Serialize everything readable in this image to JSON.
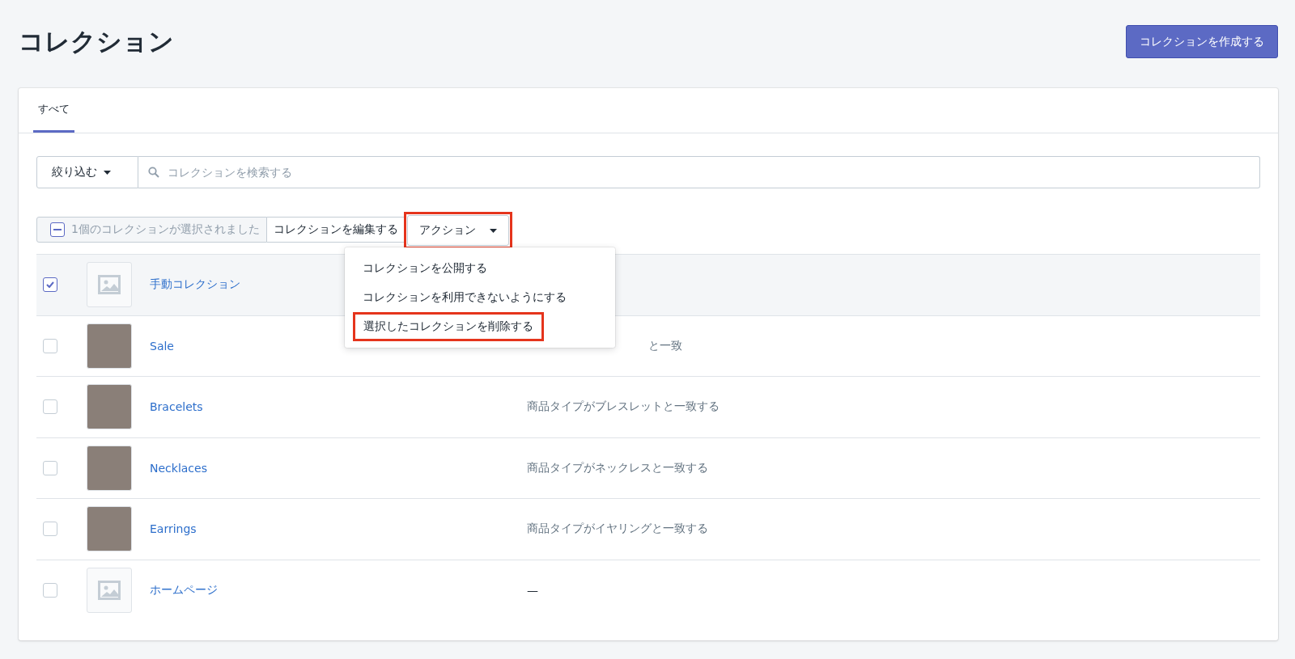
{
  "page": {
    "title": "コレクション",
    "primary_button": "コレクションを作成する"
  },
  "tabs": [
    {
      "label": "すべて",
      "selected": true
    }
  ],
  "filter": {
    "button": "絞り込む",
    "search_placeholder": "コレクションを検索する"
  },
  "bulk_bar": {
    "select_all_indeterminate": true,
    "selected_text": "1個のコレクションが選択されました",
    "edit_button": "コレクションを編集する",
    "action_button": {
      "label": "アクション",
      "highlighted": true
    }
  },
  "action_menu": {
    "open": true,
    "items": [
      {
        "label": "コレクションを公開する",
        "highlighted": false
      },
      {
        "label": "コレクションを利用できないようにする",
        "highlighted": false
      },
      {
        "label": "選択したコレクションを削除する",
        "highlighted": true
      }
    ]
  },
  "rows": [
    {
      "name": "手動コレクション",
      "checked": true,
      "kind": "placeholder"
    },
    {
      "name": "Sale",
      "condition": "と一致",
      "checked": false,
      "kind": "photo",
      "covered": true
    },
    {
      "name": "Bracelets",
      "condition": "商品タイプがブレスレットと一致する",
      "checked": false,
      "kind": "photo",
      "covered": false
    },
    {
      "name": "Necklaces",
      "condition": "商品タイプがネックレスと一致する",
      "checked": false,
      "kind": "photo",
      "covered": false
    },
    {
      "name": "Earrings",
      "condition": "商品タイプがイヤリングと一致する",
      "checked": false,
      "kind": "photo",
      "covered": false
    },
    {
      "name": "ホームページ",
      "condition": "—",
      "checked": false,
      "kind": "placeholder",
      "covered": false
    }
  ]
}
